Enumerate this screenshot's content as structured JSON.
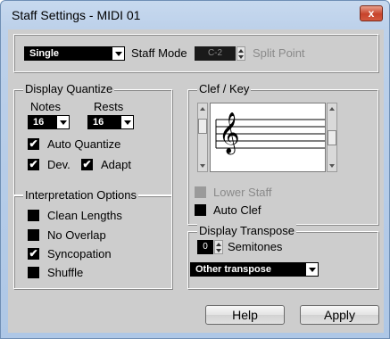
{
  "window": {
    "title": "Staff Settings - MIDI 01",
    "close_glyph": "x"
  },
  "top": {
    "mode_value": "Single",
    "staff_mode_label": "Staff Mode",
    "split_point_value": "C-2",
    "split_point_label": "Split Point"
  },
  "display_quantize": {
    "legend": "Display Quantize",
    "notes_label": "Notes",
    "rests_label": "Rests",
    "notes_value": "16",
    "rests_value": "16",
    "auto_quantize_label": "Auto Quantize",
    "auto_quantize_checked": true,
    "dev_label": "Dev.",
    "dev_checked": true,
    "adapt_label": "Adapt",
    "adapt_checked": true
  },
  "interpretation": {
    "legend": "Interpretation Options",
    "options": [
      {
        "label": "Clean Lengths",
        "checked": false
      },
      {
        "label": "No Overlap",
        "checked": false
      },
      {
        "label": "Syncopation",
        "checked": true
      },
      {
        "label": "Shuffle",
        "checked": false
      }
    ]
  },
  "clef_key": {
    "legend": "Clef / Key",
    "clef_glyph": "𝄞",
    "lower_staff_label": "Lower Staff",
    "lower_staff_enabled": false,
    "auto_clef_label": "Auto Clef",
    "auto_clef_checked": false
  },
  "display_transpose": {
    "legend": "Display Transpose",
    "semitones_value": "0",
    "semitones_label": "Semitones",
    "transpose_option": "Other transpose"
  },
  "buttons": {
    "help": "Help",
    "apply": "Apply"
  },
  "icons": {
    "checkmark": "✔"
  }
}
